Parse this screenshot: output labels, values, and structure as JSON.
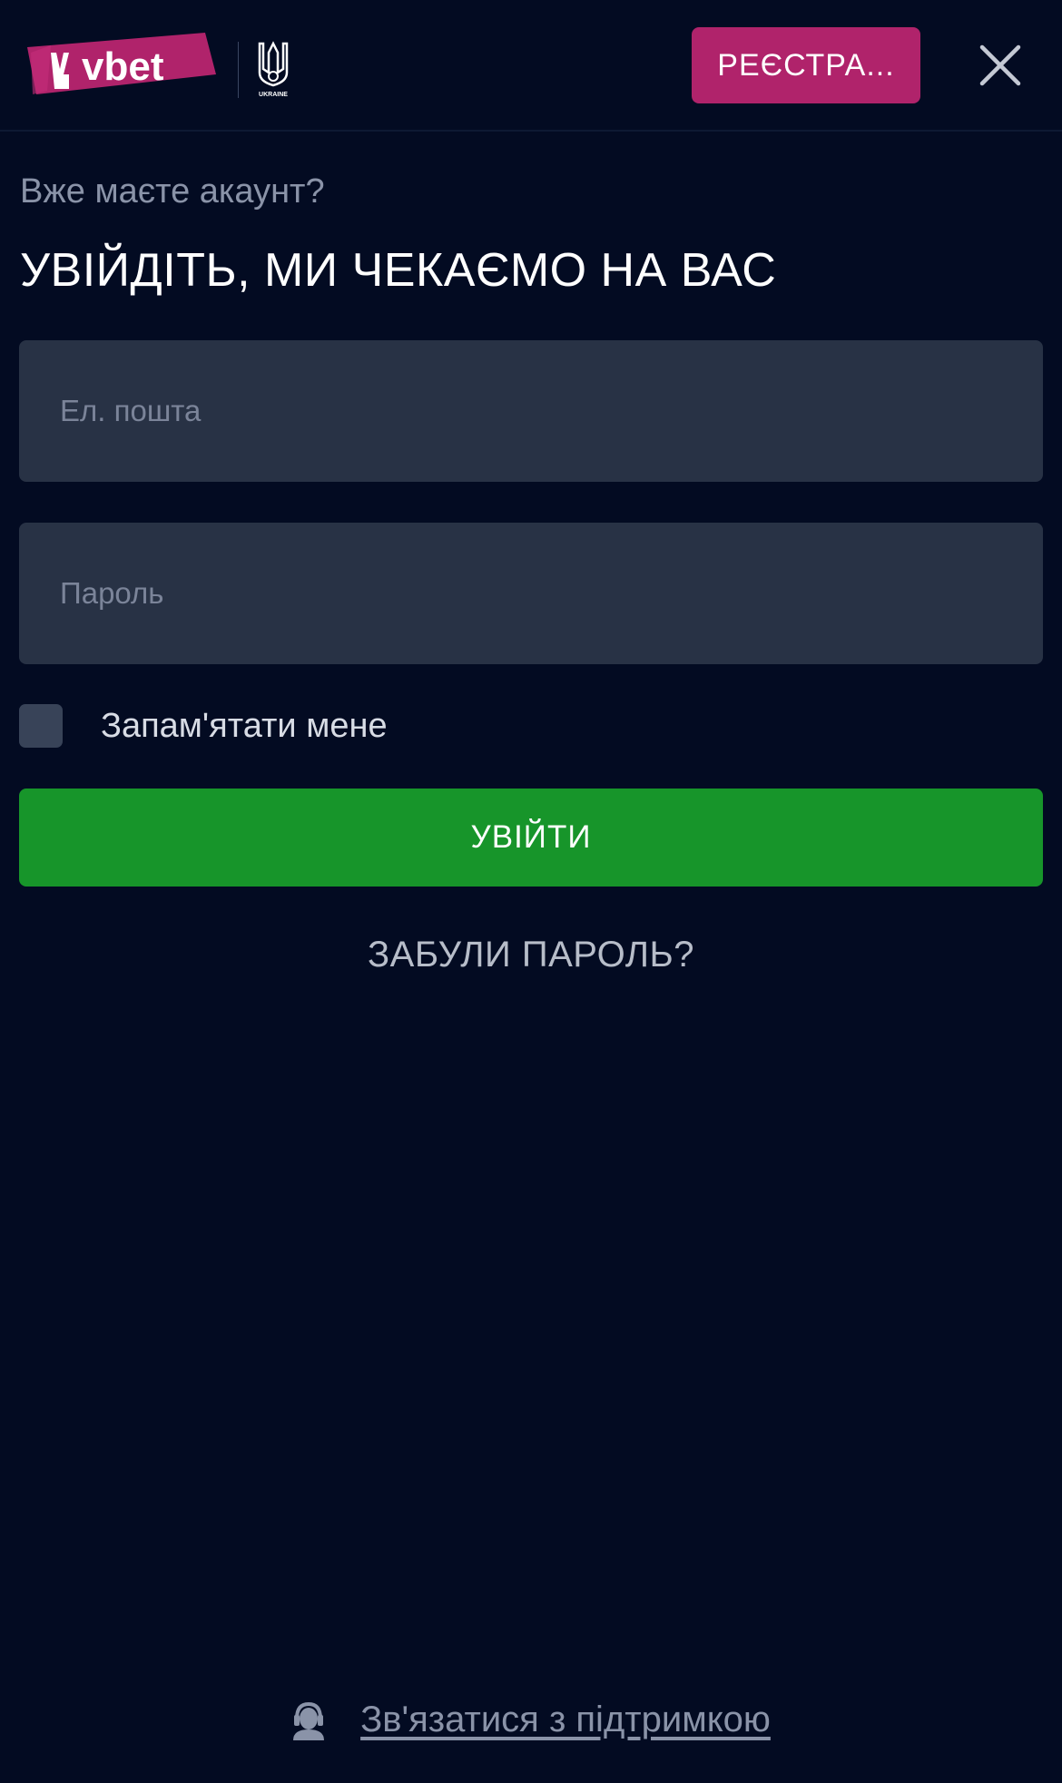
{
  "header": {
    "logo_text": "vbet",
    "crest_text": "UKRAINE",
    "register_label": "РЕЄСТРА...",
    "close_icon": "close-icon"
  },
  "login": {
    "subtitle": "Вже маєте акаунт?",
    "title": "УВІЙДІТЬ, МИ ЧЕКАЄМО НА ВАС",
    "email_placeholder": "Ел. пошта",
    "email_value": "",
    "password_placeholder": "Пароль",
    "password_value": "",
    "remember_label": "Запам'ятати мене",
    "remember_checked": false,
    "submit_label": "УВІЙТИ",
    "forgot_label": "ЗАБУЛИ ПАРОЛЬ?"
  },
  "support": {
    "icon": "support-agent-icon",
    "label": "Зв'язатися з підтримкою"
  },
  "colors": {
    "background": "#030b22",
    "register": "#b0236b",
    "login_button": "#17952a",
    "input_bg": "#283245"
  }
}
